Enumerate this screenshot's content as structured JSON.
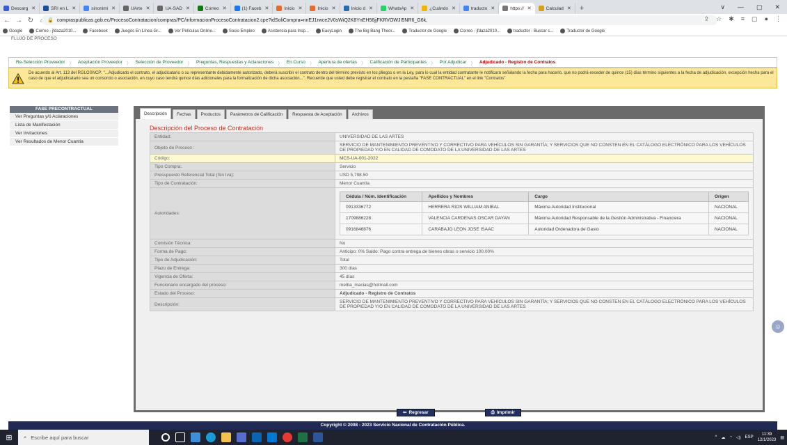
{
  "browser": {
    "tabs": [
      {
        "label": "Descarg",
        "color": "#3b5bdb"
      },
      {
        "label": "SRI en L",
        "color": "#1c4ea0"
      },
      {
        "label": "sinonimi",
        "color": "#4285f4"
      },
      {
        "label": "UArte",
        "color": "#666666"
      },
      {
        "label": "UA-SAD",
        "color": "#666666"
      },
      {
        "label": "Correo",
        "color": "#0f7b0f"
      },
      {
        "label": "(1) Faceb",
        "color": "#1877f2"
      },
      {
        "label": "Inicio",
        "color": "#e96b2a"
      },
      {
        "label": "Inicio",
        "color": "#e96b2a"
      },
      {
        "label": "Inicio d",
        "color": "#2b6cb0"
      },
      {
        "label": "WhatsAp",
        "color": "#25d366"
      },
      {
        "label": "¿Cuándo",
        "color": "#f4b400"
      },
      {
        "label": "traducto",
        "color": "#4285f4"
      },
      {
        "label": "https://",
        "color": "#777777"
      },
      {
        "label": "Calculad",
        "color": "#d4a017"
      }
    ],
    "active_tab_index": 13,
    "new_tab": "+",
    "window_controls": [
      "∨",
      "—",
      "▢",
      "✕"
    ],
    "url": "compraspublicas.gob.ec/ProcesoContratacion/compras/PC/informacionProcesoContratacion2.cpe?idSoliCompra=nnEJ1rwce2V0sWiQ2K8YnEH56jjFKRVOWJI5NR6_G6k,",
    "bookmarks": [
      "Google",
      "Correo - jfdaza2010...",
      "Facebook",
      "Juegos En Línea Gr...",
      "Ver Películas Online...",
      "Socio Empleo",
      "Asistencia para Insp...",
      "EasyLogin",
      "The Big Bang Theor...",
      "Traductor de Google",
      "Correo - jfdaza2010...",
      "traductor - Buscar c...",
      "Traductor de Google"
    ]
  },
  "page": {
    "flujo_title": "FLUJO DE PROCESO",
    "steps": [
      "Re-Selección Proveedor",
      "Aceptación Proveedor",
      "Selección de Proveedor",
      "Preguntas, Respuestas y Aclaraciones",
      "En Curso",
      "Apertura de ofertas",
      "Calificación de Participantes",
      "Por Adjudicar",
      "Adjudicado - Registro de Contratos"
    ],
    "active_step_index": 8,
    "warning": "De acuerdo al Art. 113 del RGLOSNCP: \"...Adjudicado el contrato, el adjudicatario o su representante debidamente autorizado, deberá suscribir el contrato dentro del término previsto en los pliegos o en la Ley, para lo cual la entidad contratante le notificará señalando la fecha para hacerlo, que no podrá exceder de quince (15) días término siguientes a la fecha de adjudicación, excepción hecha para el caso de que el adjudicatario sea un consorcio o asociación, en cuyo caso tendrá quince días adicionales para la formalización de dicha asociación...\". Recuerde que usted debe registrar el contrato en la pestaña \"FASE CONTRACTUAL\" en el link \"Contratos\"",
    "sidebar": {
      "header": "FASE PRECONTRACTUAL",
      "items": [
        "Ver Preguntas y/ó Aclaraciones",
        "Lista de Manifestación",
        "Ver Invitaciones",
        "Ver Resultados de Menor Cuantía"
      ]
    },
    "tabs": [
      "Descripción",
      "Fechas",
      "Productos",
      "Parámetros de Calificación",
      "Respuesta de Aceptación",
      "Archivos"
    ],
    "active_tab_index": 0,
    "section_title": "Descripción del Proceso de Contratación",
    "rows": [
      {
        "label": "Entidad:",
        "value": "UNIVERSIDAD DE LAS ARTES"
      },
      {
        "label": "Objeto de Proceso :",
        "value": "SERVICIO DE MANTENIMIENTO PREVENTIVO Y CORRECTIVO PARA VEHÍCULOS SIN GARANTÍA; Y SERVICIOS QUE NO CONSTEN EN EL CATÁLOGO ELECTRÓNICO PARA LOS VEHÍCULOS DE PROPIEDAD Y/O EN CALIDAD DE COMODATO DE LA UNIVERSIDAD DE LAS ARTES"
      },
      {
        "label": "Código:",
        "value": "MCS-UA-001-2022"
      },
      {
        "label": "Tipo Compra:",
        "value": "Servicio"
      },
      {
        "label": "Presupuesto Referencial Total (Sin Iva):",
        "value": "USD 5,798.50"
      },
      {
        "label": "Tipo de Contratación:",
        "value": "Menor Cuantía"
      }
    ],
    "authorities_label": "Autoridades:",
    "authorities_headers": [
      "Cédula / Núm. Identificación",
      "Apellidos y Nombres",
      "Cargo",
      "Origen"
    ],
    "authorities": [
      [
        "0913336772",
        "HERRERA RIOS WILLIAM ANIBAL",
        "Máxima Autoridad Institucional",
        "NACIONAL"
      ],
      [
        "1709886228",
        "VALENCIA CARDENAS OSCAR DAYAN",
        "Máxima Autoridad Responsable de la Gestión Administrativa - Financiera",
        "NACIONAL"
      ],
      [
        "0916846876",
        "CARABAJO LEON JOSE ISAAC",
        "Autoridad Ordenadora de Gasto",
        "NACIONAL"
      ]
    ],
    "rows2": [
      {
        "label": "Comisión Técnica:",
        "value": "No"
      },
      {
        "label": "Forma de Pago:",
        "value": "Anticipo: 0% Saldo: Pago contra entrega de bienes obras o servicio 100.00%"
      },
      {
        "label": "Tipo de Adjudicación:",
        "value": "Total"
      },
      {
        "label": "Plazo de Entrega:",
        "value": "300 días"
      },
      {
        "label": "Vigencia de Oferta:",
        "value": "45 días"
      },
      {
        "label": "Funcionario encargado del proceso:",
        "value": "melba_macias@hotmail.com"
      },
      {
        "label": "Estado del Proceso:",
        "value": "Adjudicado - Registro de Contratos"
      },
      {
        "label": "Descripción:",
        "value": "SERVICIO DE MANTENIMIENTO PREVENTIVO Y CORRECTIVO PARA VEHÍCULOS SIN GARANTÍA; Y SERVICIOS QUE NO CONSTEN EN EL CATÁLOGO ELECTRÓNICO PARA LOS VEHÍCULOS DE PROPIEDAD Y/O EN CALIDAD DE COMODATO DE LA UNIVERSIDAD DE LAS ARTES"
      }
    ],
    "buttons": {
      "back": "Regresar",
      "print": "Imprimir"
    },
    "footer": "Copyright © 2008 - 2023 Servicio Nacional de Contratación Pública."
  },
  "taskbar": {
    "search_placeholder": "Escribe aquí para buscar",
    "language": "ESP",
    "time": "11:39",
    "date": "12/1/2023"
  }
}
